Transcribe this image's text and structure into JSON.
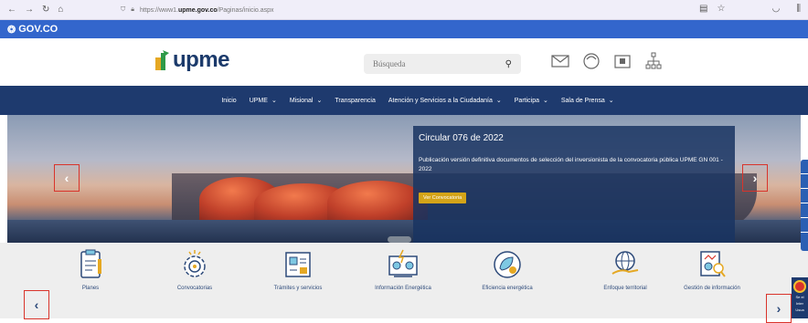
{
  "browser": {
    "url_prefix": "https://www1.",
    "url_domain": "upme.gov.co",
    "url_path": "/Paginas/inicio.aspx",
    "icons": [
      "back-icon",
      "forward-icon",
      "reload-icon",
      "home-icon",
      "shield-icon",
      "lock-icon",
      "reader-icon",
      "star-icon",
      "pocket-icon",
      "library-icon"
    ]
  },
  "gov_bar": {
    "label": "GOV.CO"
  },
  "header": {
    "logo_text": "upme",
    "search_placeholder": "Búsqueda",
    "icons": [
      "mail-icon",
      "help-icon",
      "id-card-icon",
      "sitemap-icon"
    ]
  },
  "nav": {
    "items": [
      {
        "label": "Inicio",
        "dropdown": false
      },
      {
        "label": "UPME",
        "dropdown": true
      },
      {
        "label": "Misional",
        "dropdown": true
      },
      {
        "label": "Transparencia",
        "dropdown": false
      },
      {
        "label": "Atención y Servicios a la Ciudadanía",
        "dropdown": true
      },
      {
        "label": "Participa",
        "dropdown": true
      },
      {
        "label": "Sala de Prensa",
        "dropdown": true
      }
    ]
  },
  "hero": {
    "title": "Circular 076 de 2022",
    "body": "Publicación versión definitiva documentos de selección del inversionista de la convocatoria pública UPME GN 001 - 2022",
    "button": "Ver Convocatoria",
    "prev": "‹",
    "next": "›"
  },
  "quick_links": {
    "prev": "‹",
    "next": "›",
    "items": [
      {
        "label": "Planes",
        "icon": "clipboard-icon"
      },
      {
        "label": "Convocatorias",
        "icon": "gear-badge-icon"
      },
      {
        "label": "Trámites y servicios",
        "icon": "document-screen-icon"
      },
      {
        "label": "Información Energética",
        "icon": "energy-dashboard-icon"
      },
      {
        "label": "Eficiencia energética",
        "icon": "leaf-plug-icon"
      },
      {
        "label": "Enfoque territorial",
        "icon": "globe-hand-icon"
      },
      {
        "label": "Gestión de información",
        "icon": "report-search-icon"
      }
    ]
  },
  "chat": {
    "line1": "Se el",
    "line2": "Inter",
    "line3": "Usua"
  },
  "colors": {
    "gov_blue": "#3366cc",
    "nav_blue": "#1e3a6e",
    "accent_gold": "#d4a418",
    "highlight_red": "#d9342b"
  }
}
